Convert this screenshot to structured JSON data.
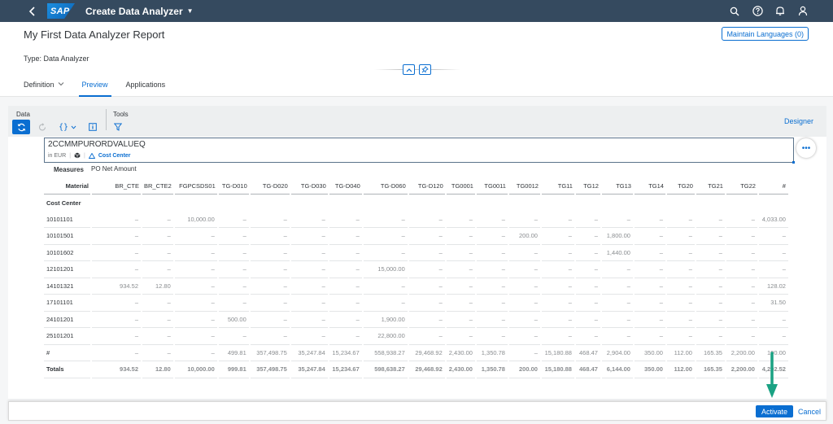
{
  "shell": {
    "logo_text": "SAP",
    "app_title": "Create Data Analyzer",
    "icons": [
      "back-icon",
      "search-icon",
      "help-icon",
      "notifications-icon",
      "user-icon"
    ]
  },
  "header": {
    "title": "My First Data Analyzer Report",
    "type_label": "Type: Data Analyzer",
    "maintain_button": "Maintain Languages (0)"
  },
  "tabs": [
    {
      "label": "Definition",
      "active": false,
      "has_dropdown": true
    },
    {
      "label": "Preview",
      "active": true,
      "has_dropdown": false
    },
    {
      "label": "Applications",
      "active": false,
      "has_dropdown": false
    }
  ],
  "toolbar": {
    "data_label": "Data",
    "tools_label": "Tools",
    "designer_label": "Designer"
  },
  "datasource": {
    "name": "2CCMMPURORDVALUEQ",
    "currency": "in EUR",
    "dimension": "Cost Center"
  },
  "measures": {
    "label": "Measures",
    "value": "PO Net Amount"
  },
  "table": {
    "corner_label": "Material",
    "columns": [
      "BR_CTE",
      "BR_CTE2",
      "FGPCSDS01",
      "TG-D010",
      "TG-D020",
      "TG-D030",
      "TG-D040",
      "TG-D060",
      "TG-D120",
      "TG0001",
      "TG0011",
      "TG0012",
      "TG11",
      "TG12",
      "TG13",
      "TG14",
      "TG20",
      "TG21",
      "TG22",
      "#"
    ],
    "section_label": "Cost Center",
    "rows": [
      {
        "label": "10101101",
        "cells": [
          "–",
          "–",
          "10,000.00",
          "–",
          "–",
          "–",
          "–",
          "–",
          "–",
          "–",
          "–",
          "–",
          "–",
          "–",
          "–",
          "–",
          "–",
          "–",
          "–",
          "4,033.00"
        ]
      },
      {
        "label": "10101501",
        "cells": [
          "–",
          "–",
          "–",
          "–",
          "–",
          "–",
          "–",
          "–",
          "–",
          "–",
          "–",
          "200.00",
          "–",
          "–",
          "1,800.00",
          "–",
          "–",
          "–",
          "–",
          "–"
        ]
      },
      {
        "label": "10101602",
        "cells": [
          "–",
          "–",
          "–",
          "–",
          "–",
          "–",
          "–",
          "–",
          "–",
          "–",
          "–",
          "–",
          "–",
          "–",
          "1,440.00",
          "–",
          "–",
          "–",
          "–",
          "–"
        ]
      },
      {
        "label": "12101201",
        "cells": [
          "–",
          "–",
          "–",
          "–",
          "–",
          "–",
          "–",
          "15,000.00",
          "–",
          "–",
          "–",
          "–",
          "–",
          "–",
          "–",
          "–",
          "–",
          "–",
          "–",
          "–"
        ]
      },
      {
        "label": "14101321",
        "cells": [
          "934.52",
          "12.80",
          "–",
          "–",
          "–",
          "–",
          "–",
          "–",
          "–",
          "–",
          "–",
          "–",
          "–",
          "–",
          "–",
          "–",
          "–",
          "–",
          "–",
          "128.02"
        ]
      },
      {
        "label": "17101101",
        "cells": [
          "–",
          "–",
          "–",
          "–",
          "–",
          "–",
          "–",
          "–",
          "–",
          "–",
          "–",
          "–",
          "–",
          "–",
          "–",
          "–",
          "–",
          "–",
          "–",
          "31.50"
        ]
      },
      {
        "label": "24101201",
        "cells": [
          "–",
          "–",
          "–",
          "500.00",
          "–",
          "–",
          "–",
          "1,900.00",
          "–",
          "–",
          "–",
          "–",
          "–",
          "–",
          "–",
          "–",
          "–",
          "–",
          "–",
          "–"
        ]
      },
      {
        "label": "25101201",
        "cells": [
          "–",
          "–",
          "–",
          "–",
          "–",
          "–",
          "–",
          "22,800.00",
          "–",
          "–",
          "–",
          "–",
          "–",
          "–",
          "–",
          "–",
          "–",
          "–",
          "–",
          "–"
        ]
      },
      {
        "label": "#",
        "cells": [
          "–",
          "–",
          "–",
          "499.81",
          "357,498.75",
          "35,247.84",
          "15,234.67",
          "558,938.27",
          "29,468.92",
          "2,430.00",
          "1,350.78",
          "–",
          "15,180.88",
          "468.47",
          "2,904.00",
          "350.00",
          "112.00",
          "165.35",
          "2,200.00",
          "100.00"
        ]
      }
    ],
    "totals": {
      "label": "Totals",
      "cells": [
        "934.52",
        "12.80",
        "10,000.00",
        "999.81",
        "357,498.75",
        "35,247.84",
        "15,234.67",
        "598,638.27",
        "29,468.92",
        "2,430.00",
        "1,350.78",
        "200.00",
        "15,180.88",
        "468.47",
        "6,144.00",
        "350.00",
        "112.00",
        "165.35",
        "2,200.00",
        "4,202.52"
      ]
    }
  },
  "footer": {
    "activate": "Activate",
    "cancel": "Cancel"
  },
  "colors": {
    "shell": "#354a5f",
    "accent": "#0a6ed1",
    "arrow": "#1aa283"
  }
}
